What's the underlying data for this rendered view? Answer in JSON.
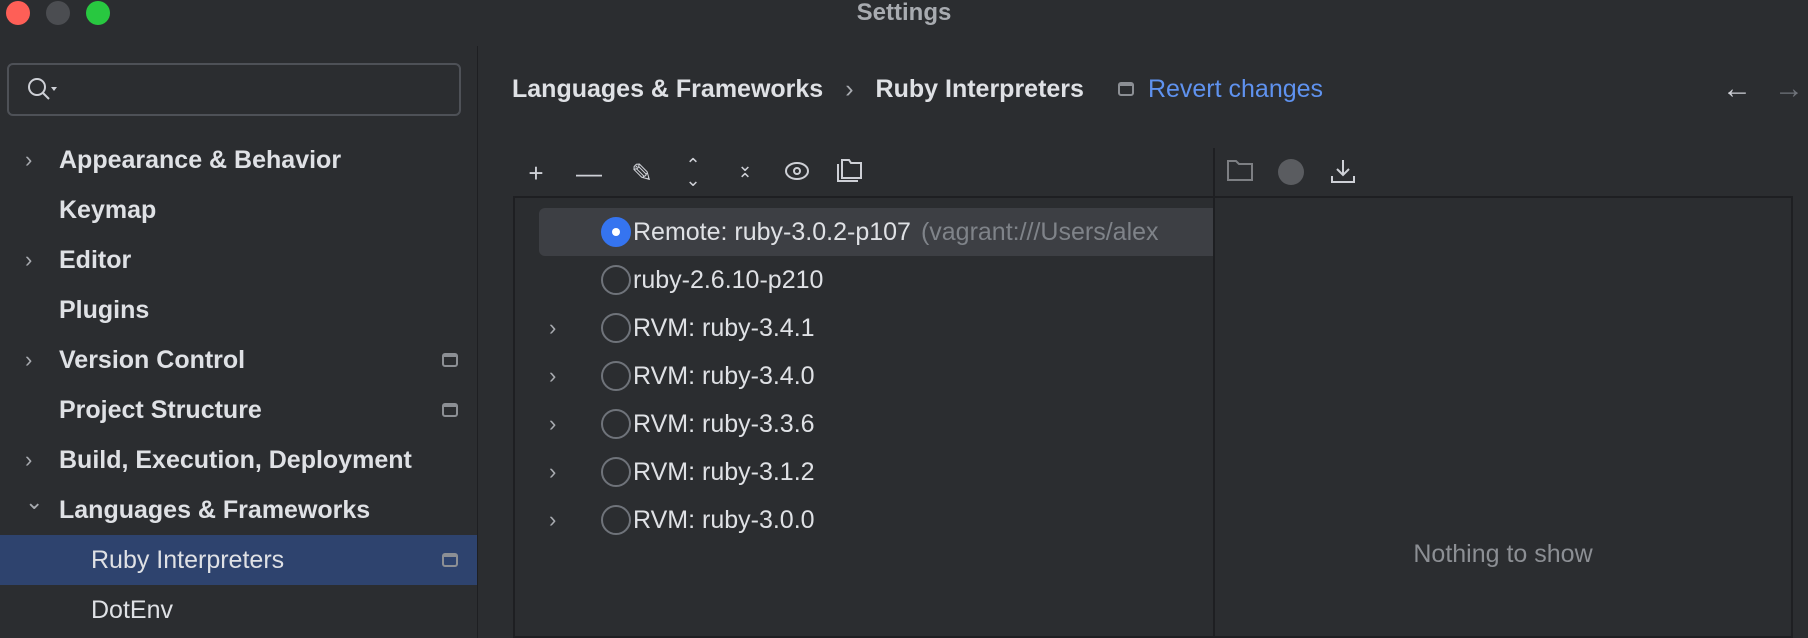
{
  "window": {
    "title": "Settings"
  },
  "search": {
    "placeholder": ""
  },
  "sidebar": {
    "items": [
      {
        "label": "Appearance & Behavior",
        "expandable": true
      },
      {
        "label": "Keymap"
      },
      {
        "label": "Editor",
        "expandable": true
      },
      {
        "label": "Plugins"
      },
      {
        "label": "Version Control",
        "expandable": true,
        "pin": true
      },
      {
        "label": "Project Structure",
        "pin": true
      },
      {
        "label": "Build, Execution, Deployment",
        "expandable": true
      },
      {
        "label": "Languages & Frameworks",
        "expanded": true
      },
      {
        "label": "Ruby Interpreters",
        "child": true,
        "selected": true,
        "pin": true
      },
      {
        "label": "DotEnv",
        "child": true
      }
    ]
  },
  "breadcrumb": {
    "parent": "Languages & Frameworks",
    "separator": "›",
    "current": "Ruby Interpreters",
    "revert": "Revert changes"
  },
  "interpreters": [
    {
      "name": "Remote: ruby-3.0.2-p107",
      "detail": "(vagrant:///Users/alex",
      "selected": true
    },
    {
      "name": "ruby-2.6.10-p210"
    },
    {
      "name": "RVM: ruby-3.4.1",
      "expandable": true
    },
    {
      "name": "RVM: ruby-3.4.0",
      "expandable": true
    },
    {
      "name": "RVM: ruby-3.3.6",
      "expandable": true
    },
    {
      "name": "RVM: ruby-3.1.2",
      "expandable": true
    },
    {
      "name": "RVM: ruby-3.0.0",
      "expandable": true
    }
  ],
  "gems": {
    "empty_text": "Nothing to show"
  },
  "colors": {
    "accent": "#3574f0",
    "link": "#5f92ef",
    "selection": "#2e436e"
  }
}
